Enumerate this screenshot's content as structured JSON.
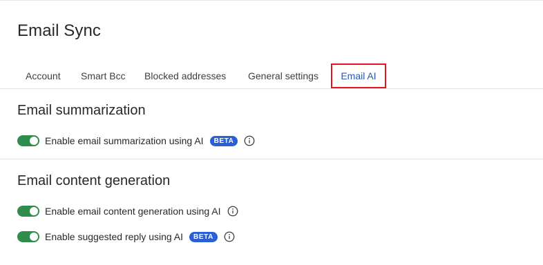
{
  "page": {
    "title": "Email Sync"
  },
  "tabs": [
    {
      "label": "Account"
    },
    {
      "label": "Smart Bcc"
    },
    {
      "label": "Blocked addresses"
    },
    {
      "label": "General settings"
    },
    {
      "label": "Email AI",
      "active": true
    }
  ],
  "sections": [
    {
      "title": "Email summarization",
      "settings": [
        {
          "label": "Enable email summarization using AI",
          "enabled": true,
          "badge": "BETA",
          "icon": "info-icon"
        }
      ]
    },
    {
      "title": "Email content generation",
      "settings": [
        {
          "label": "Enable email content generation using AI",
          "enabled": true,
          "icon": "info-icon"
        },
        {
          "label": "Enable suggested reply using AI",
          "enabled": true,
          "badge": "BETA",
          "icon": "info-icon"
        }
      ]
    }
  ],
  "colors": {
    "toggle_on": "#2f8d4b",
    "badge_bg": "#2b5fd6",
    "active_tab": "#2a56b8",
    "highlight_box": "#e1141e"
  }
}
